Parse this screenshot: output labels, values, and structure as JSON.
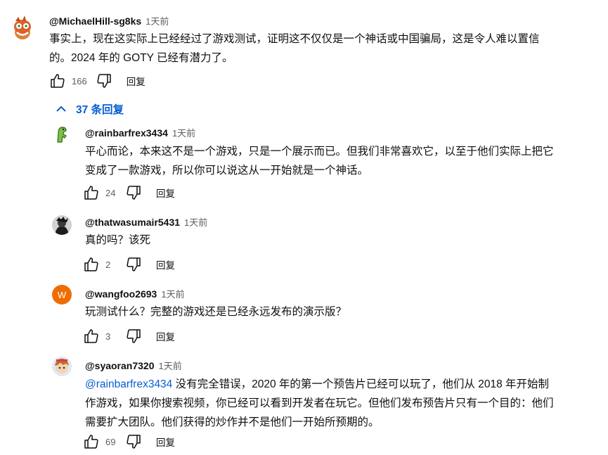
{
  "comment": {
    "author": "@MichaelHill-sg8ks",
    "time": "1天前",
    "line1": "事实上，现在这实际上已经经过了游戏测试，证明这不仅仅是一个神话或中国骗局，这是令人难以置信",
    "line2": "的。2024 年的 GOTY 已经有潜力了。",
    "likes": "166",
    "reply_label": "回复"
  },
  "replies_toggle": {
    "label": "37 条回复"
  },
  "replies": [
    {
      "author": "@rainbarfrex3434",
      "time": "1天前",
      "line1": "平心而论，本来这不是一个游戏，只是一个展示而已。但我们非常喜欢它，以至于他们实际上把它",
      "line2": "变成了一款游戏，所以你可以说这从一开始就是一个神话。",
      "likes": "24",
      "reply_label": "回复"
    },
    {
      "author": "@thatwasumair5431",
      "time": "1天前",
      "line1": "真的吗？该死",
      "likes": "2",
      "reply_label": "回复"
    },
    {
      "author": "@wangfoo2693",
      "time": "1天前",
      "avatar_letter": "W",
      "line1": "玩测试什么？完整的游戏还是已经永远发布的演示版？",
      "likes": "3",
      "reply_label": "回复"
    },
    {
      "author": "@syaoran7320",
      "time": "1天前",
      "mention": "@rainbarfrex3434",
      "line1": " 没有完全错误，2020 年的第一个预告片已经可以玩了，他们从 2018 年开始制",
      "line2": "作游戏，如果你搜索视频，你已经可以看到开发者在玩它。但他们发布预告片只有一个目的：他们",
      "line3": "需要扩大团队。他们获得的炒作并不是他们一开始所预期的。",
      "likes": "69",
      "reply_label": "回复"
    }
  ],
  "colors": {
    "link": "#065fd4",
    "muted": "#606060",
    "avatar_w": "#ef6c00"
  }
}
